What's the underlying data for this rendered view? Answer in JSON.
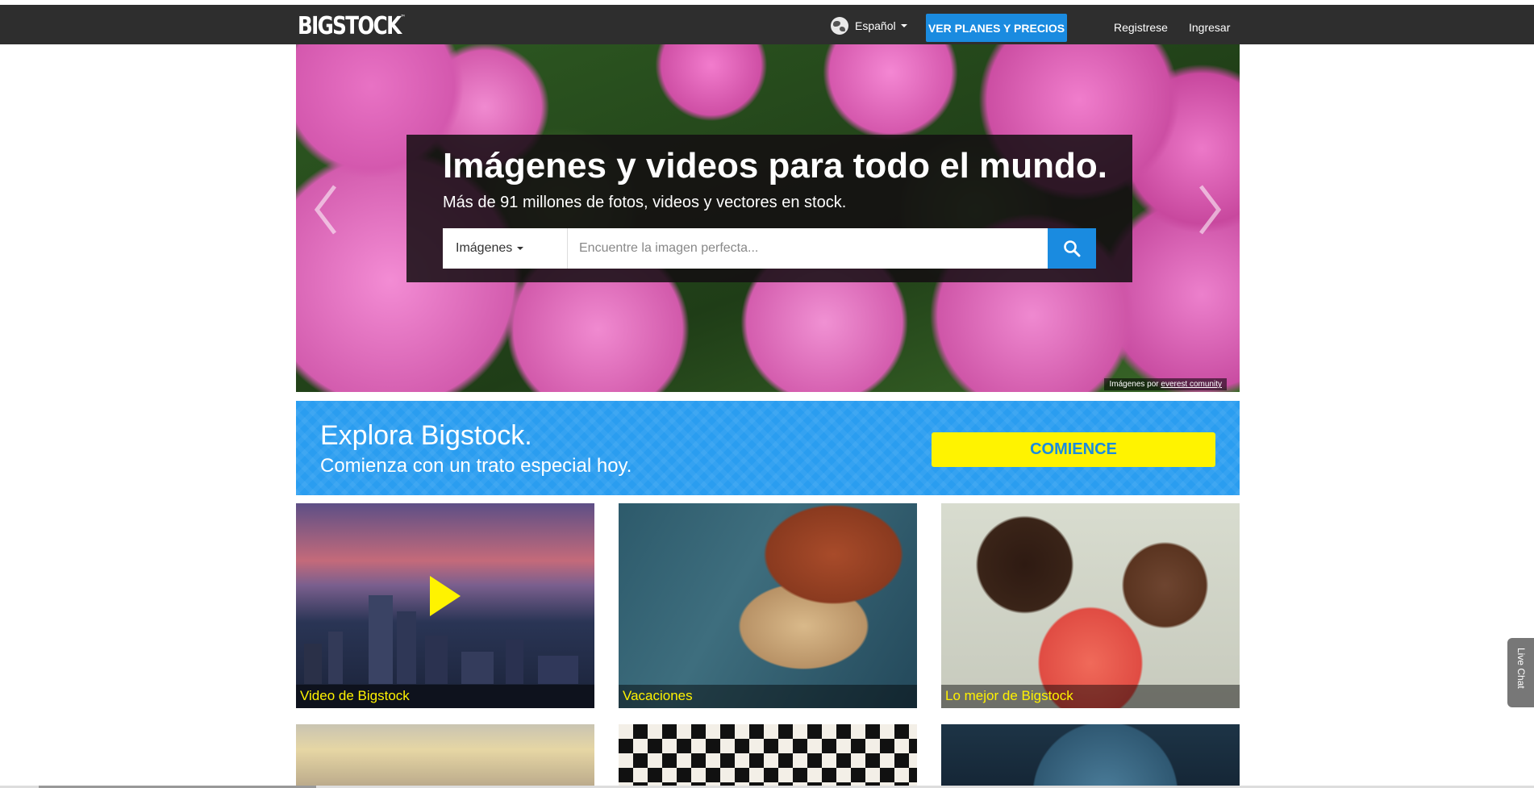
{
  "brand": {
    "logo": "BIGSTOCK",
    "tm": "™"
  },
  "nav": {
    "language": "Español",
    "plans_button": "VER PLANES Y PRECIOS",
    "register": "Registrese",
    "login": "Ingresar"
  },
  "hero": {
    "title": "Imágenes y videos para todo el mundo.",
    "subtitle": "Más de 91 millones de fotos, videos y vectores en stock.",
    "search_type": "Imágenes",
    "search_placeholder": "Encuentre la imagen perfecta...",
    "credit_prefix": "Imágenes por",
    "credit_author": "everest comunity"
  },
  "promo": {
    "title": "Explora Bigstock.",
    "subtitle": "Comienza con un trato especial hoy.",
    "button": "COMIENCE"
  },
  "tiles": [
    {
      "label": "Video de Bigstock"
    },
    {
      "label": "Vacaciones"
    },
    {
      "label": "Lo mejor de Bigstock"
    }
  ],
  "live_chat": "Live Chat",
  "colors": {
    "accent": "#1a8be0",
    "promo_bg": "#2a9df0",
    "cta_yellow": "#fff300",
    "navbar": "#2e2e2e"
  },
  "icons": [
    "globe-icon",
    "caret-down-icon",
    "search-icon",
    "chevron-left-icon",
    "chevron-right-icon",
    "play-icon"
  ]
}
